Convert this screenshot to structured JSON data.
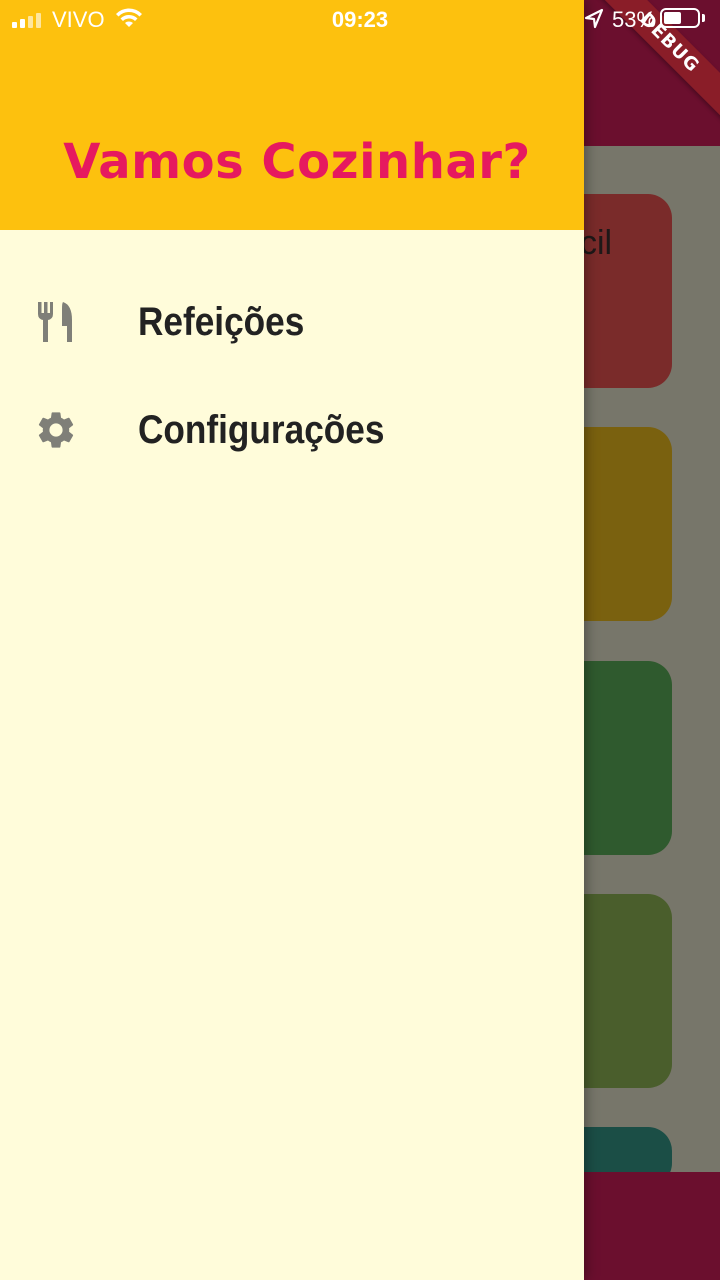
{
  "status_bar": {
    "carrier": "VIVO",
    "time": "09:23",
    "battery_text": "53%",
    "battery_level": 0.53
  },
  "debug_banner": "DEBUG",
  "drawer": {
    "title": "Vamos Cozinhar?",
    "items": [
      {
        "label": "Refeições",
        "icon": "restaurant-icon"
      },
      {
        "label": "Configurações",
        "icon": "settings-icon"
      }
    ]
  },
  "background": {
    "card_partial_text": "cil"
  },
  "colors": {
    "drawer_header": "#fdc10e",
    "drawer_title": "#e6195f",
    "drawer_body": "#fffcda",
    "appbar": "#6b0f2e"
  }
}
